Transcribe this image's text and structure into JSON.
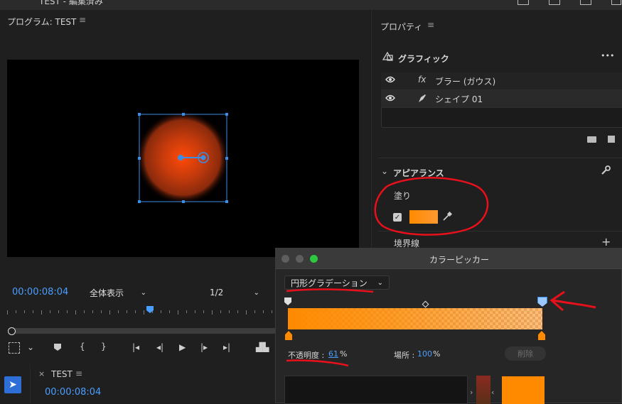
{
  "app": {
    "window_title_partial": "TEST - 編集済み"
  },
  "program_monitor": {
    "title": "プログラム: TEST",
    "timecode": "00:00:08:04",
    "zoom": "全体表示",
    "resolution": "1/2"
  },
  "properties": {
    "title": "プロパティ",
    "graphic_label": "グラフィック",
    "more": "•••",
    "layers": [
      {
        "name": "ブラー (ガウス)",
        "icon": "fx"
      },
      {
        "name": "シェイプ 01",
        "icon": "pen-icon"
      }
    ],
    "appearance_label": "アピアランス",
    "fill_label": "塗り",
    "fill_checked": true,
    "stroke_label": "境界線"
  },
  "color_picker": {
    "title": "カラーピッカー",
    "gradient_type": "円形グラデーション",
    "opacity_label": "不透明度 :",
    "opacity_value": "61",
    "opacity_unit": "%",
    "location_label": "場所 :",
    "location_value": "100",
    "location_unit": "%",
    "delete_label": "削除",
    "colors": {
      "gradient_start": "#ff8a00",
      "gradient_end": "#ffa040"
    }
  },
  "timeline": {
    "title": "TEST",
    "timecode": "00:00:08:04"
  },
  "colors": {
    "accent": "#4a9eff",
    "annotation": "#e8101a"
  }
}
